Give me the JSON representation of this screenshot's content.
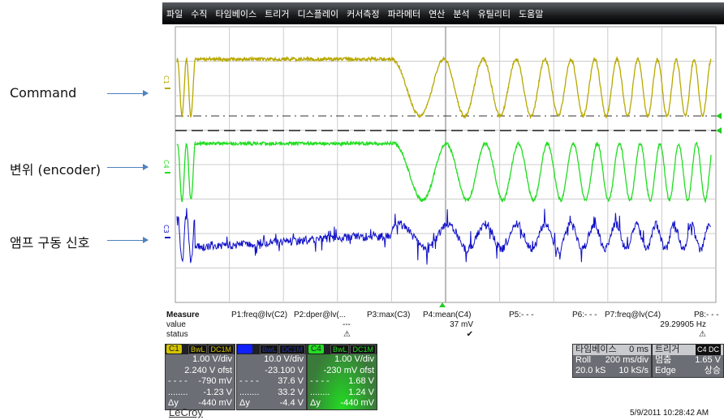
{
  "annotations": [
    {
      "label": "Command"
    },
    {
      "label": "변위 (encoder)"
    },
    {
      "label": "앰프 구동 신호"
    }
  ],
  "menu": [
    "파일",
    "수직",
    "타임베이스",
    "트리거",
    "디스플레이",
    "커서측정",
    "파라메터",
    "연산",
    "분석",
    "유틸리티",
    "도움말"
  ],
  "channels_on_plot": [
    {
      "label": "C1",
      "color": "#b8a800"
    },
    {
      "label": "C4",
      "color": "#22dd22"
    },
    {
      "label": "C3",
      "color": "#1010c8"
    }
  ],
  "measure": {
    "title": "Measure",
    "value_label": "value",
    "status_label": "status",
    "params": [
      {
        "name": "P1:freq@lv(C2)",
        "value": "",
        "status": ""
      },
      {
        "name": "P2:dper@lv(...",
        "value": "---",
        "status": "⚠"
      },
      {
        "name": "P3:max(C3)",
        "value": "",
        "status": ""
      },
      {
        "name": "P4:mean(C4)",
        "value": "37 mV",
        "status": "✔"
      },
      {
        "name": "P5:- - -",
        "value": "",
        "status": ""
      },
      {
        "name": "P6:- - -",
        "value": "",
        "status": ""
      },
      {
        "name": "P7:freq@lv(C4)",
        "value": "29.29905 Hz",
        "status": "⚠"
      },
      {
        "name": "P8:- - -",
        "value": "",
        "status": ""
      }
    ]
  },
  "channel_boxes": [
    {
      "tag": "C1",
      "bw": "BwL",
      "cpl": "DC1M",
      "vdiv": "1.00 V/div",
      "ofst": "2.240 V ofst",
      "c1": "-790 mV",
      "c2": "-1.23 V",
      "dy": "-440 mV",
      "tag_color": "#d4c400"
    },
    {
      "tag": "",
      "bw": "BwL",
      "cpl": "DC1M",
      "vdiv": "10.0 V/div",
      "ofst": "-23.100 V",
      "c1": "37.6 V",
      "c2": "33.2 V",
      "dy": "-4.4 V",
      "tag_color": "#1020ff"
    },
    {
      "tag": "C4",
      "bw": "BwL",
      "cpl": "DC1M",
      "vdiv": "1.00 V/div",
      "ofst": "-230 mV ofst",
      "c1": "1.68 V",
      "c2": "1.24 V",
      "dy": "-440 mV",
      "tag_color": "#22dd22"
    }
  ],
  "cursor_labels": {
    "c1": "- - - -",
    "c2": "........",
    "dy": "Δy"
  },
  "timebase": {
    "title": "타임베이스",
    "delay": "0 ms",
    "mode": "Roll",
    "tdiv": "200 ms/div",
    "samples": "20.0 kS",
    "rate": "10 kS/s"
  },
  "trigger": {
    "title": "트리거",
    "src": "C4",
    "cpl": "DC",
    "level_label": "멈춤",
    "level": "1.65 V",
    "type": "Edge",
    "slope": "상승"
  },
  "brand": "LeCroy",
  "timestamp": "5/9/2011 10:28:42 AM"
}
